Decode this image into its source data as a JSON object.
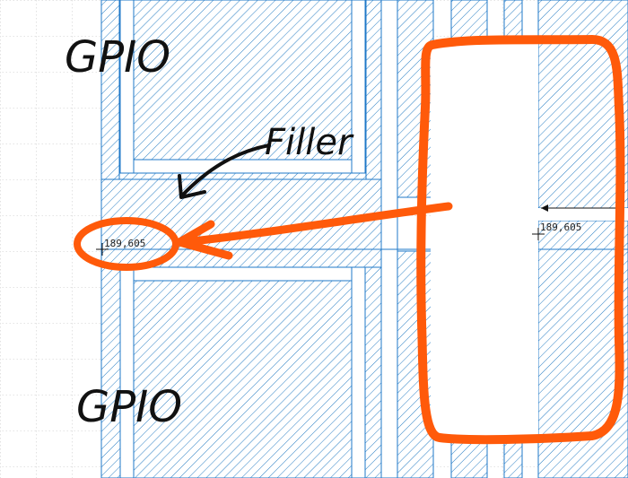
{
  "annotations": {
    "top_label": "GPIO",
    "bottom_label": "GPIO",
    "filler_label": "Filler"
  },
  "coordinates": {
    "left_readout": "189,605",
    "right_readout": "189,605"
  },
  "colors": {
    "background": "#ffffff",
    "grid": "#b8b8b8",
    "hatch": "#2a7fc4",
    "outline": "#1f78c8",
    "highlight": "#ff5a0a",
    "ink": "#111111"
  },
  "icons": {
    "cursor": "crosshair-icon",
    "pointer": "arrow-icon"
  }
}
